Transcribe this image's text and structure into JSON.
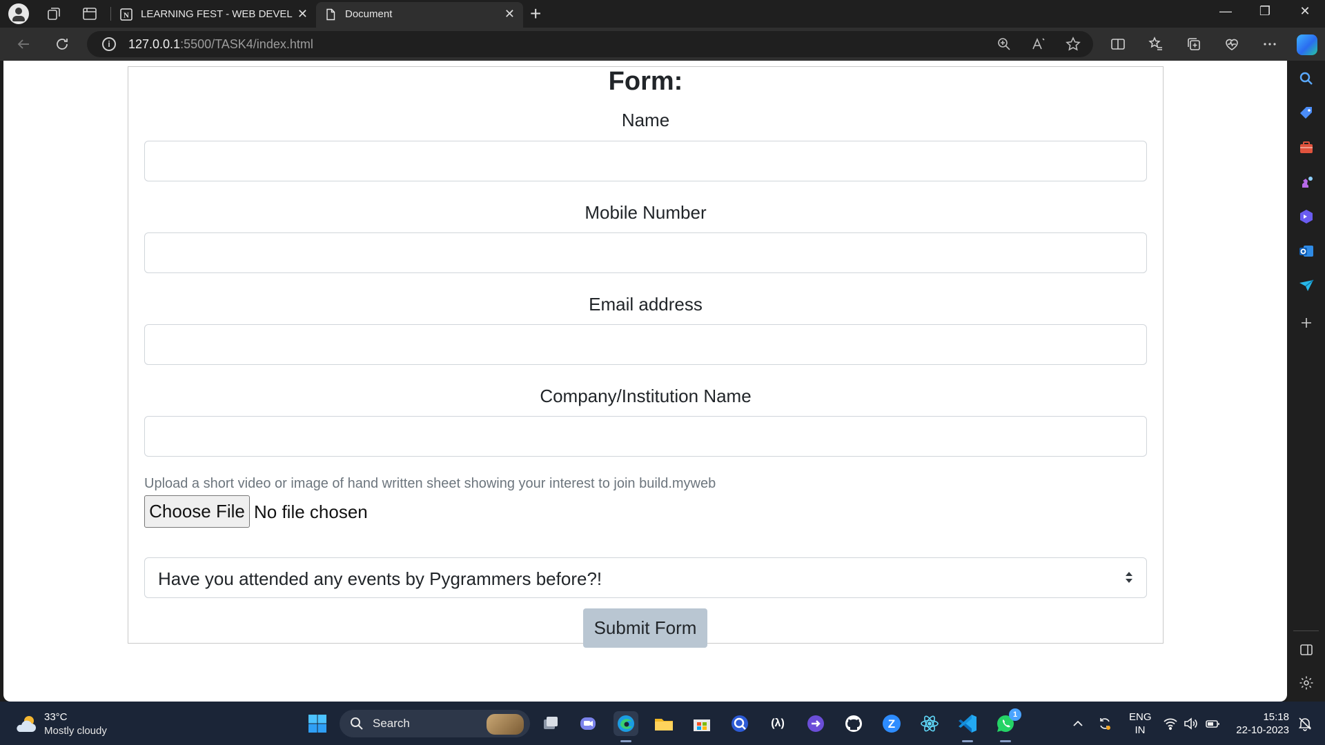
{
  "browser": {
    "tabs": [
      {
        "title": "LEARNING FEST - WEB DEVELOPI",
        "active": false
      },
      {
        "title": "Document",
        "active": true
      }
    ],
    "address": {
      "host": "127.0.0.1",
      "rest": ":5500/TASK4/index.html"
    }
  },
  "form": {
    "title": "Form:",
    "fields": [
      {
        "label": "Name",
        "value": ""
      },
      {
        "label": "Mobile Number",
        "value": ""
      },
      {
        "label": "Email address",
        "value": ""
      },
      {
        "label": "Company/Institution Name",
        "value": ""
      }
    ],
    "upload_hint": "Upload a short video or image of hand written sheet showing your interest to join build.myweb",
    "file_button": "Choose File",
    "file_status": "No file chosen",
    "select_value": "Have you attended any events by Pygrammers before?!",
    "submit": "Submit Form"
  },
  "taskbar": {
    "weather": {
      "temp": "33°C",
      "desc": "Mostly cloudy"
    },
    "search_label": "Search",
    "whatsapp_badge": "1",
    "lang": {
      "top": "ENG",
      "bottom": "IN"
    },
    "clock": {
      "time": "15:18",
      "date": "22-10-2023"
    }
  },
  "colors": {
    "accent": "#0078d4",
    "submit_bg": "#b9c6d2",
    "taskbar_bg": "#1b2537"
  }
}
